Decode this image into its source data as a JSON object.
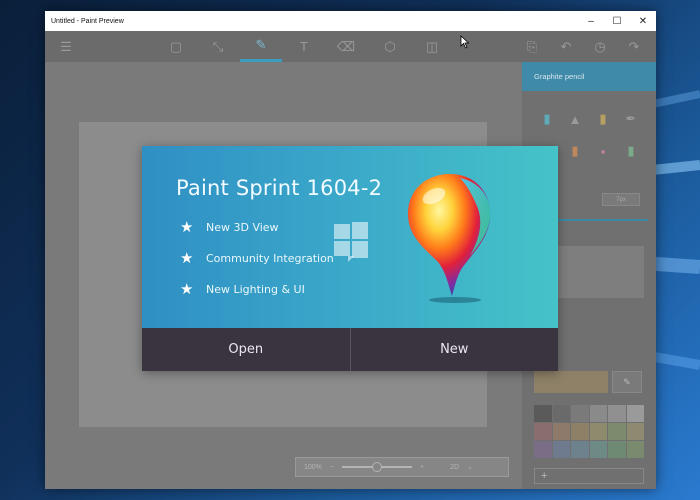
{
  "window": {
    "title": "Untitled - Paint Preview",
    "controls": {
      "minimize": "–",
      "maximize": "☐",
      "close": "✕"
    }
  },
  "toolbar": {
    "icons": [
      "menu-icon",
      "select-icon",
      "crop-icon",
      "brush-icon",
      "text-icon",
      "sticker-icon",
      "3d-icon",
      "canvas-icon",
      "paste-icon",
      "undo-icon",
      "history-icon",
      "redo-icon"
    ],
    "active": "brush-icon"
  },
  "panel": {
    "header": "Graphite pencil",
    "size_value": "7px"
  },
  "zoom": {
    "value": "100%",
    "minus": "−",
    "plus": "+",
    "view_mode": "2D",
    "dropdown": "⌄"
  },
  "splash": {
    "title": "Paint Sprint 1604-2",
    "features": [
      "New 3D View",
      "Community Integration",
      "New Lighting & UI"
    ],
    "open_label": "Open",
    "new_label": "New"
  },
  "colors": {
    "accent": "#3f8aa8",
    "splash_gradient_start": "#2f8fc4",
    "splash_gradient_end": "#45c3c8",
    "splash_buttons": "#3a3340"
  }
}
